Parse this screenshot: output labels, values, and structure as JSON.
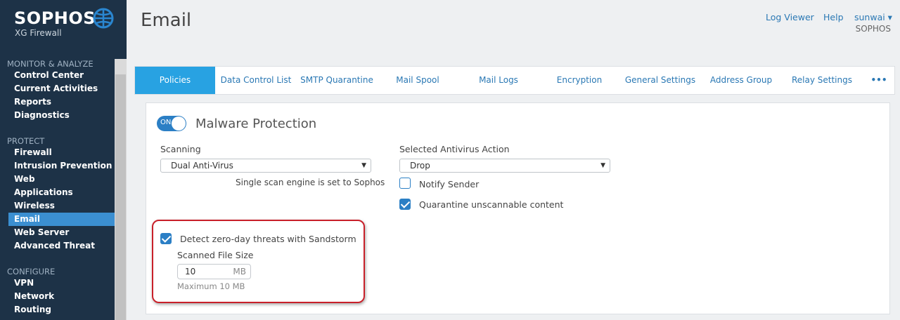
{
  "brand": {
    "name": "SOPHOS",
    "product": "XG Firewall",
    "logo_icon": "sophos-globe-icon"
  },
  "header": {
    "title": "Email",
    "log_viewer": "Log Viewer",
    "help": "Help",
    "user": "sunwai ▾",
    "org": "SOPHOS"
  },
  "sidebar": {
    "sections": [
      {
        "title": "MONITOR & ANALYZE",
        "items": [
          "Control Center",
          "Current Activities",
          "Reports",
          "Diagnostics"
        ]
      },
      {
        "title": "PROTECT",
        "items": [
          "Firewall",
          "Intrusion Prevention",
          "Web",
          "Applications",
          "Wireless",
          "Email",
          "Web Server",
          "Advanced Threat"
        ]
      },
      {
        "title": "CONFIGURE",
        "items": [
          "VPN",
          "Network",
          "Routing"
        ]
      }
    ],
    "active_item": "Email"
  },
  "tabs": [
    {
      "label": "Policies",
      "active": true
    },
    {
      "label": "Data Control List"
    },
    {
      "label": "SMTP Quarantine"
    },
    {
      "label": "Mail Spool"
    },
    {
      "label": "Mail Logs"
    },
    {
      "label": "Encryption"
    },
    {
      "label": "General Settings"
    },
    {
      "label": "Address Group"
    },
    {
      "label": "Relay Settings"
    },
    {
      "label": "•••"
    }
  ],
  "malware": {
    "toggle_label": "ON",
    "toggle_on": true,
    "title": "Malware Protection",
    "scanning_label": "Scanning",
    "scanning_value": "Dual Anti-Virus",
    "scan_hint": "Single scan engine is set to Sophos",
    "action_label": "Selected Antivirus Action",
    "action_value": "Drop",
    "notify_sender": {
      "label": "Notify Sender",
      "checked": false
    },
    "quarantine": {
      "label": "Quarantine unscannable content",
      "checked": true
    },
    "sandstorm": {
      "label": "Detect zero-day threats with Sandstorm",
      "checked": true
    },
    "file_size_label": "Scanned File Size",
    "file_size_value": "10",
    "file_size_unit": "MB",
    "file_size_max": "Maximum 10 MB"
  },
  "colors": {
    "sidebar_bg": "#1d3247",
    "accent": "#28a2e2",
    "link": "#2a78b4",
    "highlight": "#c8202a"
  }
}
